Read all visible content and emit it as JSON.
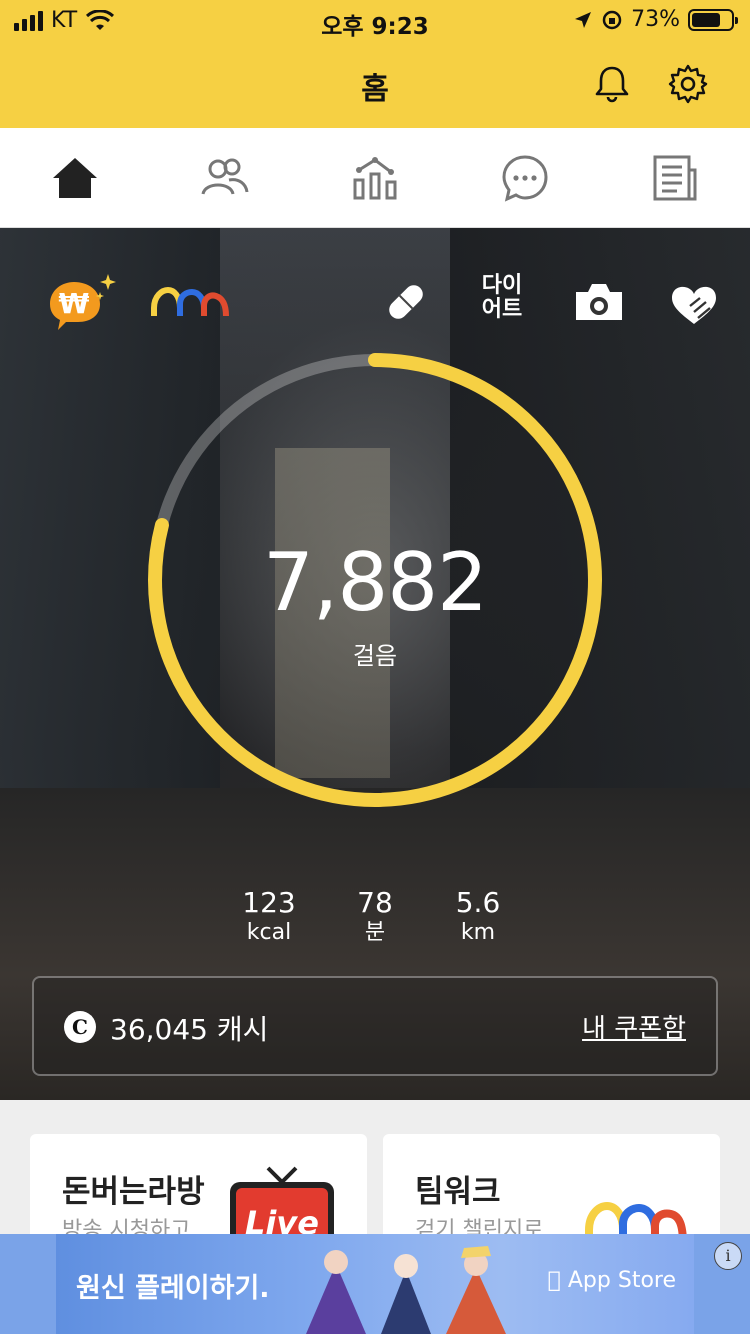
{
  "status_bar": {
    "carrier": "KT",
    "time": "오후 9:23",
    "battery": "73%",
    "battery_level": 0.73
  },
  "header": {
    "title": "홈",
    "icons": [
      "bell-icon",
      "gear-icon"
    ]
  },
  "tabs": [
    "home-icon",
    "friends-icon",
    "stats-icon",
    "chat-icon",
    "news-icon"
  ],
  "shortcuts": {
    "diet_label": "다이\n어트",
    "icons": [
      "money-icon",
      "teamwork-logo",
      "pill-icon",
      "camera-icon",
      "heart-hand-icon"
    ]
  },
  "pedometer": {
    "steps": "7,882",
    "steps_label": "걸음",
    "progress": 0.79
  },
  "metrics": [
    {
      "value": "123",
      "unit": "kcal"
    },
    {
      "value": "78",
      "unit": "분"
    },
    {
      "value": "5.6",
      "unit": "km"
    }
  ],
  "cash": {
    "coin_symbol": "C",
    "amount": "36,045 캐시",
    "coupon_link": "내 쿠폰함"
  },
  "cards": [
    {
      "title": "돈버는라방",
      "subtitle": "방송 시청하고",
      "badge": "Live"
    },
    {
      "title": "팀워크",
      "subtitle": "걷기 챌린지로"
    }
  ],
  "ad": {
    "text": "원신 플레이하기.",
    "store": "App Store",
    "info": "i"
  },
  "colors": {
    "accent": "#f6d043",
    "orange": "#f39a1e",
    "blue": "#2f6de0",
    "red": "#e04b2f"
  }
}
